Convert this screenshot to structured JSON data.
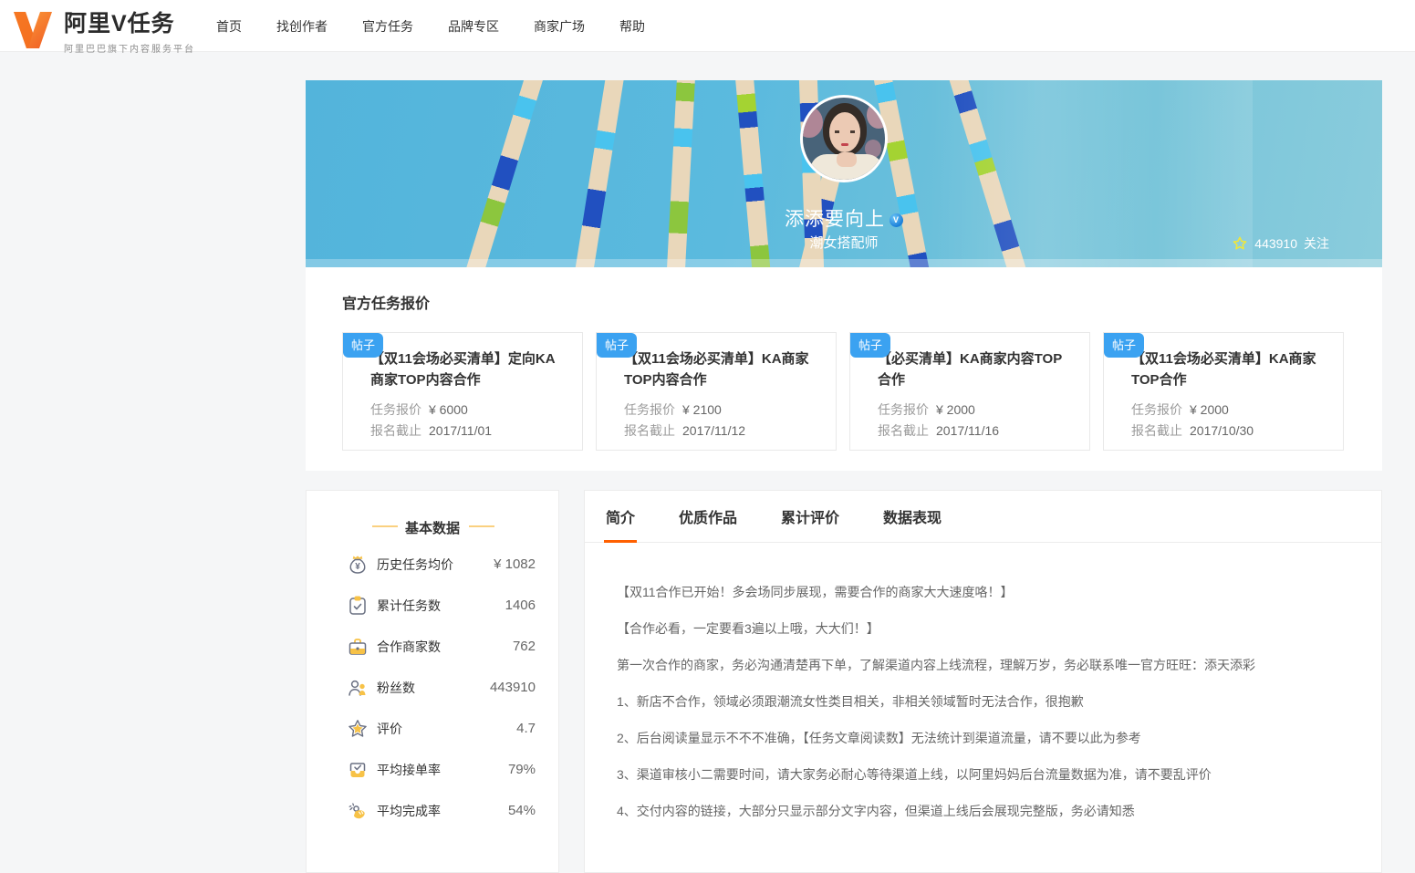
{
  "header": {
    "logo_title": "阿里V任务",
    "logo_subtitle": "阿里巴巴旗下内容服务平台",
    "nav": [
      {
        "label": "首页"
      },
      {
        "label": "找创作者"
      },
      {
        "label": "官方任务"
      },
      {
        "label": "品牌专区"
      },
      {
        "label": "商家广场"
      },
      {
        "label": "帮助"
      }
    ]
  },
  "banner": {
    "name": "添添要向上",
    "verified_badge": "V",
    "category": "潮女搭配师",
    "follow_count": "443910",
    "follow_label": "关注"
  },
  "tasks": {
    "section_title": "官方任务报价",
    "badge_label": "帖子",
    "price_label": "任务报价",
    "deadline_label": "报名截止",
    "items": [
      {
        "title": "【双11会场必买清单】定向KA商家TOP内容合作",
        "price": "¥ 6000",
        "deadline": "2017/11/01"
      },
      {
        "title": "【双11会场必买清单】KA商家TOP内容合作",
        "price": "¥ 2100",
        "deadline": "2017/11/12"
      },
      {
        "title": "【必买清单】KA商家内容TOP合作",
        "price": "¥ 2000",
        "deadline": "2017/11/16"
      },
      {
        "title": "【双11会场必买清单】KA商家TOP合作",
        "price": "¥ 2000",
        "deadline": "2017/10/30"
      }
    ]
  },
  "stats": {
    "title": "基本数据",
    "rows": [
      {
        "icon": "money-bag-icon",
        "label": "历史任务均价",
        "value": "¥ 1082"
      },
      {
        "icon": "task-count-icon",
        "label": "累计任务数",
        "value": "1406"
      },
      {
        "icon": "briefcase-icon",
        "label": "合作商家数",
        "value": "762"
      },
      {
        "icon": "fans-icon",
        "label": "粉丝数",
        "value": "443910"
      },
      {
        "icon": "star-icon",
        "label": "评价",
        "value": "4.7"
      },
      {
        "icon": "accept-rate-icon",
        "label": "平均接单率",
        "value": "79%"
      },
      {
        "icon": "complete-rate-icon",
        "label": "平均完成率",
        "value": "54%"
      }
    ]
  },
  "profile": {
    "tabs": [
      {
        "label": "简介",
        "active": true
      },
      {
        "label": "优质作品",
        "active": false
      },
      {
        "label": "累计评价",
        "active": false
      },
      {
        "label": "数据表现",
        "active": false
      }
    ],
    "paragraphs": [
      "【双11合作已开始！多会场同步展现，需要合作的商家大大速度咯！】",
      "【合作必看，一定要看3遍以上哦，大大们！】",
      "第一次合作的商家，务必沟通清楚再下单，了解渠道内容上线流程，理解万岁，务必联系唯一官方旺旺：添天添彩",
      "1、新店不合作，领域必须跟潮流女性类目相关，非相关领域暂时无法合作，很抱歉",
      "2、后台阅读量显示不不不准确，【任务文章阅读数】无法统计到渠道流量，请不要以此为参考",
      "3、渠道审核小二需要时间，请大家务必耐心等待渠道上线，以阿里妈妈后台流量数据为准，请不要乱评价",
      "4、交付内容的链接，大部分只显示部分文字内容，但渠道上线后会展现完整版，务必请知悉"
    ]
  },
  "colors": {
    "accent_orange": "#ff6000",
    "badge_blue": "#3ba2f1",
    "banner_blue": "#58b7dd",
    "gold": "#f7c247",
    "star_yellow": "#f0e73b",
    "logo_orange": "#f4701f"
  }
}
